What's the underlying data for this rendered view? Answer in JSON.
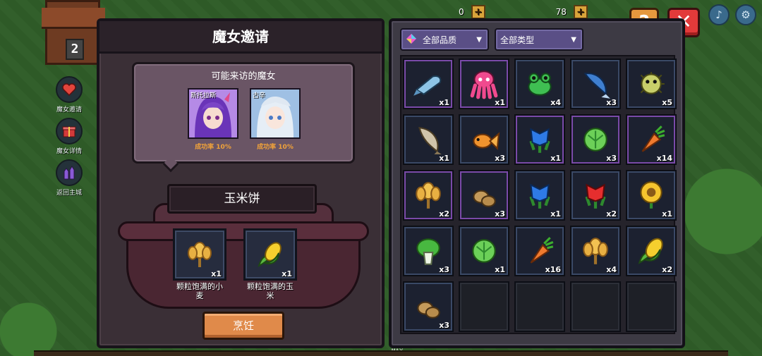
{
  "hud": {
    "level": "2",
    "resources": [
      {
        "value": "0"
      },
      {
        "value": "78"
      }
    ],
    "help_label": "?",
    "close_label": "✕"
  },
  "side_nav": [
    {
      "label": "魔女邀请",
      "icon": "heart-icon"
    },
    {
      "label": "魔女详情",
      "icon": "gift-icon"
    },
    {
      "label": "返回主城",
      "icon": "castle-icon"
    }
  ],
  "left_panel": {
    "title": "魔女邀请",
    "witch_card": {
      "title": "可能来访的魔女",
      "witches": [
        {
          "name": "斯托拉斯",
          "rate": "成功率 10%",
          "hair": "#7b45c6",
          "accent": "#e04a8a"
        },
        {
          "name": "古辛",
          "rate": "成功率 10%",
          "hair": "#e6eef6",
          "accent": "#4a7ac6"
        }
      ]
    },
    "dish_name": "玉米饼",
    "ingredients": [
      {
        "name": "颗粒饱满的小麦",
        "qty": "x1",
        "icon": "wheat-icon"
      },
      {
        "name": "颗粒饱满的玉米",
        "qty": "x1",
        "icon": "corn-icon"
      }
    ],
    "cook_label": "烹饪"
  },
  "right_panel": {
    "filters": {
      "quality": "全部品质",
      "type": "全部类型"
    },
    "items": [
      {
        "icon": "blue-fish-icon",
        "qty": "x1",
        "rare": true
      },
      {
        "icon": "octopus-icon",
        "qty": "x1",
        "rare": true
      },
      {
        "icon": "frog-icon",
        "qty": "x4",
        "rare": false
      },
      {
        "icon": "dolphin-fish-icon",
        "qty": "x3",
        "rare": false
      },
      {
        "icon": "pufferfish-icon",
        "qty": "x5",
        "rare": false
      },
      {
        "icon": "catfish-icon",
        "qty": "x1",
        "rare": false
      },
      {
        "icon": "goldfish-icon",
        "qty": "x3",
        "rare": false
      },
      {
        "icon": "blue-flower-icon",
        "qty": "x1",
        "rare": true
      },
      {
        "icon": "lettuce-icon",
        "qty": "x3",
        "rare": true
      },
      {
        "icon": "carrot-icon",
        "qty": "x14",
        "rare": true
      },
      {
        "icon": "wheat-icon",
        "qty": "x2",
        "rare": true
      },
      {
        "icon": "potato-icon",
        "qty": "x3",
        "rare": true
      },
      {
        "icon": "blue-flower-icon",
        "qty": "x1",
        "rare": false
      },
      {
        "icon": "red-flower-icon",
        "qty": "x2",
        "rare": false
      },
      {
        "icon": "sunflower-icon",
        "qty": "x1",
        "rare": false
      },
      {
        "icon": "bok-choy-icon",
        "qty": "x3",
        "rare": false
      },
      {
        "icon": "lettuce-icon",
        "qty": "x1",
        "rare": false
      },
      {
        "icon": "carrot-icon",
        "qty": "x16",
        "rare": false
      },
      {
        "icon": "wheat-icon",
        "qty": "x4",
        "rare": false
      },
      {
        "icon": "corn-icon",
        "qty": "x2",
        "rare": false
      },
      {
        "icon": "potato-icon",
        "qty": "x3",
        "rare": false
      },
      {
        "icon": "",
        "qty": "",
        "rare": false
      },
      {
        "icon": "",
        "qty": "",
        "rare": false
      },
      {
        "icon": "",
        "qty": "",
        "rare": false
      },
      {
        "icon": "",
        "qty": "",
        "rare": false
      }
    ]
  },
  "footer": {
    "max_label": "MAX"
  }
}
